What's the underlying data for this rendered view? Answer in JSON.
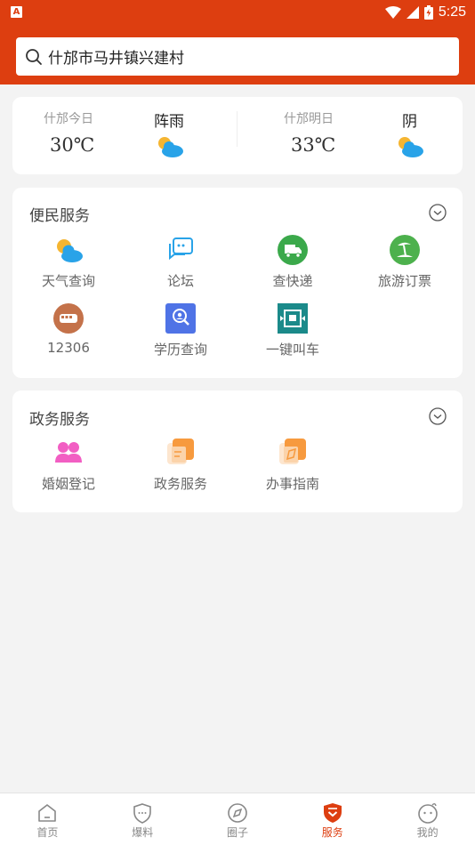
{
  "status_bar": {
    "app_badge": "A",
    "time": "5:25"
  },
  "search": {
    "value": "什邡市马井镇兴建村"
  },
  "weather": {
    "today": {
      "label": "什邡今日",
      "temp": "30℃",
      "condition": "阵雨",
      "icon": "partly-cloudy-icon"
    },
    "tomorrow": {
      "label": "什邡明日",
      "temp": "33℃",
      "condition": "阴",
      "icon": "partly-cloudy-icon"
    }
  },
  "convenience": {
    "title": "便民服务",
    "items": [
      {
        "label": "天气查询",
        "icon": "weather-icon"
      },
      {
        "label": "论坛",
        "icon": "forum-icon"
      },
      {
        "label": "查快递",
        "icon": "express-truck-icon"
      },
      {
        "label": "旅游订票",
        "icon": "travel-island-icon"
      },
      {
        "label": "12306",
        "icon": "train-icon"
      },
      {
        "label": "学历查询",
        "icon": "education-search-icon"
      },
      {
        "label": "一键叫车",
        "icon": "taxi-icon"
      }
    ]
  },
  "government": {
    "title": "政务服务",
    "items": [
      {
        "label": "婚姻登记",
        "icon": "marriage-icon"
      },
      {
        "label": "政务服务",
        "icon": "gov-service-icon"
      },
      {
        "label": "办事指南",
        "icon": "guide-icon"
      }
    ]
  },
  "tabs": [
    {
      "label": "首页",
      "icon": "home-icon",
      "active": false
    },
    {
      "label": "爆料",
      "icon": "shield-chat-icon",
      "active": false
    },
    {
      "label": "圈子",
      "icon": "compass-icon",
      "active": false
    },
    {
      "label": "服务",
      "icon": "service-shield-icon",
      "active": true
    },
    {
      "label": "我的",
      "icon": "face-icon",
      "active": false
    }
  ],
  "colors": {
    "brand": "#dd3e10",
    "card_bg": "#ffffff",
    "page_bg": "#f3f3f3"
  }
}
